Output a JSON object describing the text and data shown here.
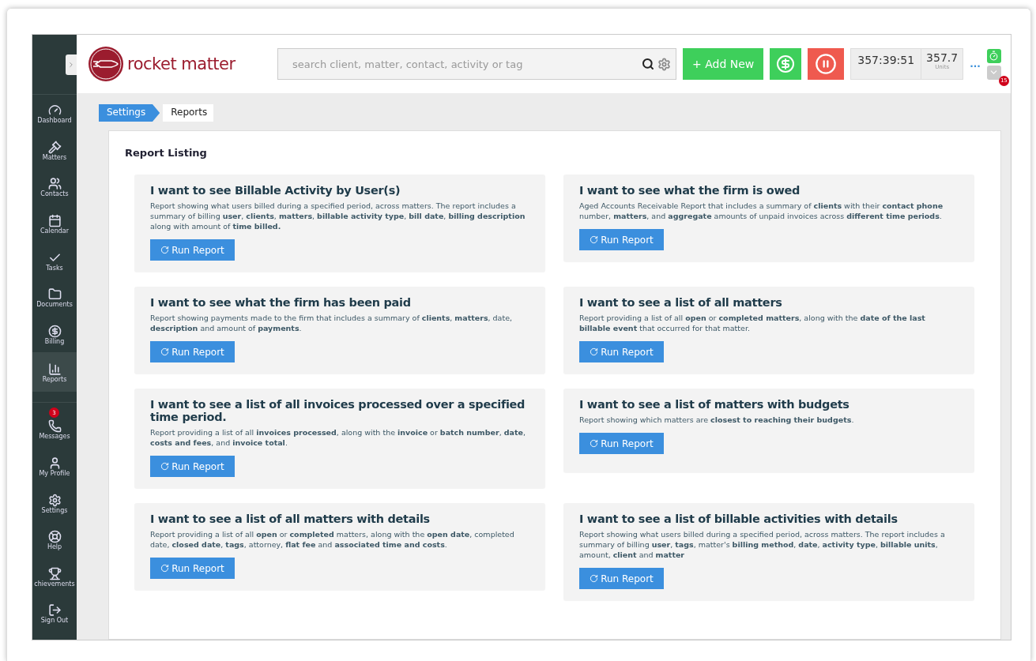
{
  "sidebar": {
    "items": [
      {
        "label": "Dashboard",
        "selected": false
      },
      {
        "label": "Matters",
        "selected": false
      },
      {
        "label": "Contacts",
        "selected": false
      },
      {
        "label": "Calendar",
        "selected": false
      },
      {
        "label": "Tasks",
        "selected": false
      },
      {
        "label": "Documents",
        "selected": false
      },
      {
        "label": "Billing",
        "selected": false
      },
      {
        "label": "Reports",
        "selected": true
      },
      {
        "label": "Messages",
        "selected": false,
        "badge": "3"
      },
      {
        "label": "My Profile",
        "selected": false
      },
      {
        "label": "Settings",
        "selected": false
      },
      {
        "label": "Help",
        "selected": false
      },
      {
        "label": "chievements",
        "selected": false
      },
      {
        "label": "Sign Out",
        "selected": false
      }
    ]
  },
  "header": {
    "logo": "rocket matter",
    "search": {
      "placeholder": "search client, matter, contact, activity or tag"
    },
    "add_button": "+ Add New",
    "timer": "357:39:51",
    "units": "357.7",
    "units_label": "Units",
    "more": "...",
    "notification_count": "15"
  },
  "breadcrumb": [
    {
      "label": "Settings",
      "selected": false
    },
    {
      "label": "Reports",
      "selected": true
    }
  ],
  "panel": {
    "title": "Report Listing",
    "reports": [
      {
        "title": "I want to see Billable Activity by User(s)",
        "description": "Report showing what users billed during a specified period, across matters. The report includes a summary of billing **user**, **clients**, **matters**, **billable activity type**, **bill date**, **billing description** along with amount of **time billed.**",
        "button": "Run Report"
      },
      {
        "title": "I want to see what the firm is owed",
        "description": "Aged Accounts Receivable Report that includes a summary of **clients** with their **contact phone** number, **matters**, and **aggregate** amounts of unpaid invoices across **different time periods**.",
        "button": "Run Report"
      },
      {
        "title": "I want to see what the firm has been paid",
        "description": "Report showing payments made to the firm that includes a summary of **clients**, **matters**, date, **description** and amount of **payments**.",
        "button": "Run Report"
      },
      {
        "title": "I want to see a list of all matters",
        "description": "Report providing a list of all **open** or **completed matters**, along with the **date of the last billable event** that occurred for that matter.",
        "button": "Run Report"
      },
      {
        "title": "I want to see a list of all invoices processed over a specified time period.",
        "description": "Report providing a list of all **invoices processed**, along with the **invoice** or **batch number**, **date**, **costs and fees**, and **invoice total**.",
        "button": "Run Report"
      },
      {
        "title": "I want to see a list of matters with budgets",
        "description": "Report showing which matters are **closest to reaching their budgets**.",
        "button": "Run Report"
      },
      {
        "title": "I want to see a list of all matters with details",
        "description": "Report providing a list of all **open** or **completed** matters, along with the **open date**, completed date, **closed date**, **tags**, attorney, **flat fee** and **associated time and costs**.",
        "button": "Run Report"
      },
      {
        "title": "I want to see a list of billable activities with details",
        "description": "Report showing what users billed during a specified period, across matters. The report includes a summary of billing **user**, **tags**, matter's **billing method**, **date**, **activity type**, **billable units**, amount, **client** and **matter**",
        "button": "Run Report"
      }
    ]
  }
}
